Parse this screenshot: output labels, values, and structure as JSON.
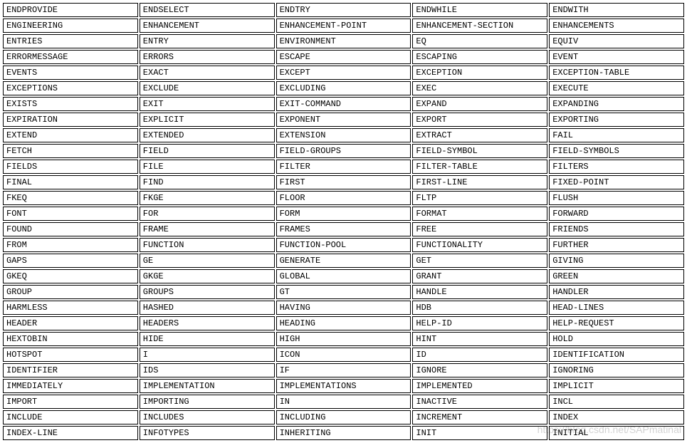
{
  "table": {
    "rows": [
      [
        "ENDPROVIDE",
        "ENDSELECT",
        "ENDTRY",
        "ENDWHILE",
        "ENDWITH"
      ],
      [
        "ENGINEERING",
        "ENHANCEMENT",
        "ENHANCEMENT-POINT",
        "ENHANCEMENT-SECTION",
        "ENHANCEMENTS"
      ],
      [
        "ENTRIES",
        "ENTRY",
        "ENVIRONMENT",
        "EQ",
        "EQUIV"
      ],
      [
        "ERRORMESSAGE",
        "ERRORS",
        "ESCAPE",
        "ESCAPING",
        "EVENT"
      ],
      [
        "EVENTS",
        "EXACT",
        "EXCEPT",
        "EXCEPTION",
        "EXCEPTION-TABLE"
      ],
      [
        "EXCEPTIONS",
        "EXCLUDE",
        "EXCLUDING",
        "EXEC",
        "EXECUTE"
      ],
      [
        "EXISTS",
        "EXIT",
        "EXIT-COMMAND",
        "EXPAND",
        "EXPANDING"
      ],
      [
        "EXPIRATION",
        "EXPLICIT",
        "EXPONENT",
        "EXPORT",
        "EXPORTING"
      ],
      [
        "EXTEND",
        "EXTENDED",
        "EXTENSION",
        "EXTRACT",
        "FAIL"
      ],
      [
        "FETCH",
        "FIELD",
        "FIELD-GROUPS",
        "FIELD-SYMBOL",
        "FIELD-SYMBOLS"
      ],
      [
        "FIELDS",
        "FILE",
        "FILTER",
        "FILTER-TABLE",
        "FILTERS"
      ],
      [
        "FINAL",
        "FIND",
        "FIRST",
        "FIRST-LINE",
        "FIXED-POINT"
      ],
      [
        "FKEQ",
        "FKGE",
        "FLOOR",
        "FLTP",
        "FLUSH"
      ],
      [
        "FONT",
        "FOR",
        "FORM",
        "FORMAT",
        "FORWARD"
      ],
      [
        "FOUND",
        "FRAME",
        "FRAMES",
        "FREE",
        "FRIENDS"
      ],
      [
        "FROM",
        "FUNCTION",
        "FUNCTION-POOL",
        "FUNCTIONALITY",
        "FURTHER"
      ],
      [
        "GAPS",
        "GE",
        "GENERATE",
        "GET",
        "GIVING"
      ],
      [
        "GKEQ",
        "GKGE",
        "GLOBAL",
        "GRANT",
        "GREEN"
      ],
      [
        "GROUP",
        "GROUPS",
        "GT",
        "HANDLE",
        "HANDLER"
      ],
      [
        "HARMLESS",
        "HASHED",
        "HAVING",
        "HDB",
        "HEAD-LINES"
      ],
      [
        "HEADER",
        "HEADERS",
        "HEADING",
        "HELP-ID",
        "HELP-REQUEST"
      ],
      [
        "HEXTOBIN",
        "HIDE",
        "HIGH",
        "HINT",
        "HOLD"
      ],
      [
        "HOTSPOT",
        "I",
        "ICON",
        "ID",
        "IDENTIFICATION"
      ],
      [
        "IDENTIFIER",
        "IDS",
        "IF",
        "IGNORE",
        "IGNORING"
      ],
      [
        "IMMEDIATELY",
        "IMPLEMENTATION",
        "IMPLEMENTATIONS",
        "IMPLEMENTED",
        "IMPLICIT"
      ],
      [
        "IMPORT",
        "IMPORTING",
        "IN",
        "INACTIVE",
        "INCL"
      ],
      [
        "INCLUDE",
        "INCLUDES",
        "INCLUDING",
        "INCREMENT",
        "INDEX"
      ],
      [
        "INDEX-LINE",
        "INFOTYPES",
        "INHERITING",
        "INIT",
        "INITIAL"
      ]
    ]
  },
  "watermark": "https://blog.csdn.net/SAPmatinal"
}
